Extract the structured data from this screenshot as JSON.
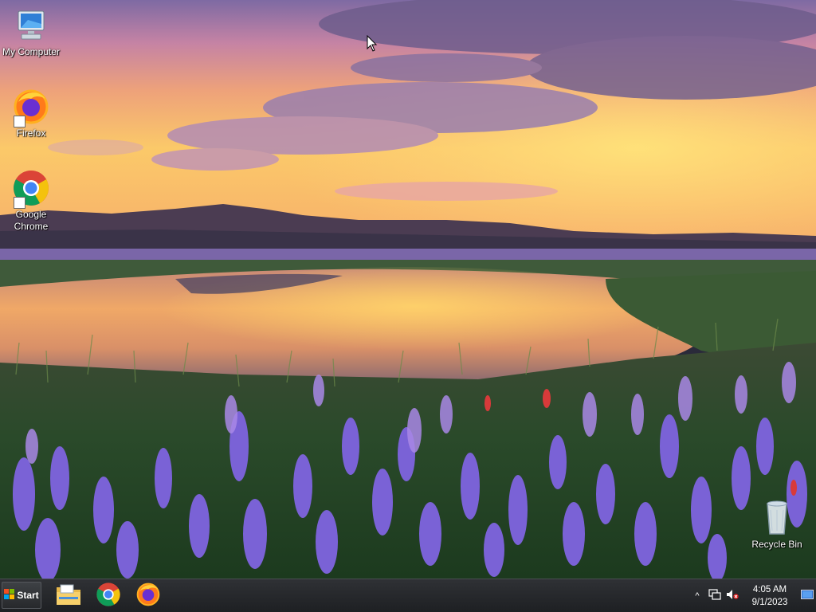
{
  "desktop": {
    "icons": [
      {
        "label": "My Computer",
        "icon": "my-computer-icon"
      },
      {
        "label": "Firefox",
        "icon": "firefox-icon"
      },
      {
        "label": "Google\nChrome",
        "icon": "chrome-icon"
      },
      {
        "label": "Recycle Bin",
        "icon": "recycle-bin-icon"
      }
    ]
  },
  "taskbar": {
    "start_label": "Start",
    "pinned": [
      {
        "name": "File Explorer",
        "icon": "file-explorer-icon"
      },
      {
        "name": "Google Chrome",
        "icon": "chrome-icon"
      },
      {
        "name": "Firefox",
        "icon": "firefox-icon"
      }
    ],
    "tray": {
      "overflow_glyph": "^",
      "time": "4:05 AM",
      "date": "9/1/2023"
    }
  },
  "colors": {
    "taskbar_bg": "#25272a",
    "label_text": "#ffffff"
  }
}
